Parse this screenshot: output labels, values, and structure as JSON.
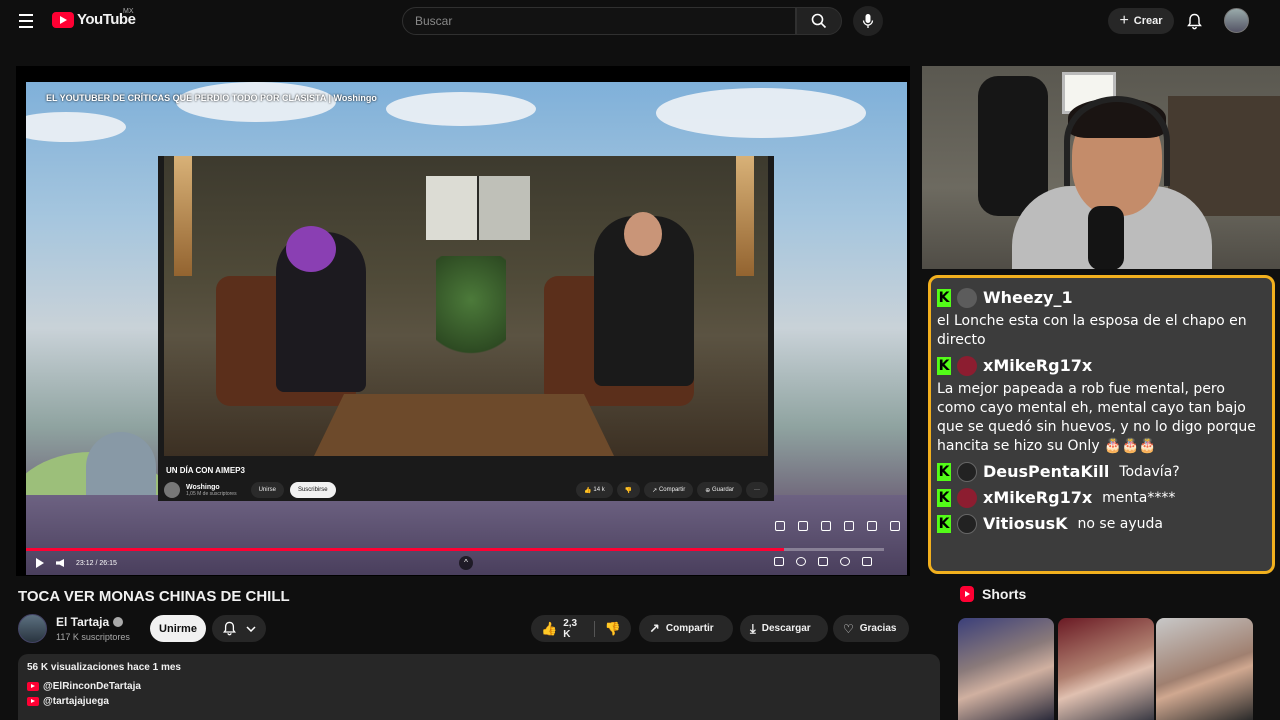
{
  "header": {
    "logo_text": "YouTube",
    "country_code": "MX",
    "search_placeholder": "Buscar",
    "create_label": "Crear"
  },
  "player": {
    "overlay_title": "EL YOUTUBER DE CRÍTICAS QUE PERDIO TODO POR CLASISTA | Woshingo",
    "inner": {
      "title": "UN DÍA CON AIMEP3",
      "channel": "Woshingo",
      "subs": "1,05 M de suscriptores",
      "join": "Unirse",
      "subscribe": "Suscribirse",
      "likes": "14 k",
      "share": "Compartir",
      "save": "Guardar"
    },
    "time_current": "23:12",
    "time_total": "26:15",
    "time_display": "23:12 / 26:15",
    "progress_fraction": 0.884
  },
  "stream": {
    "chat": [
      {
        "user": "Wheezy_1",
        "avatar": "gray",
        "text": "el Lonche esta con la esposa de el chapo en directo",
        "inline": false
      },
      {
        "user": "xMikeRg17x",
        "avatar": "red",
        "text": "La mejor papeada a rob fue mental, pero como cayo mental eh, mental cayo tan bajo que se quedó sin huevos, y no lo digo porque hancita se hizo su Only 🎂🎂🎂",
        "inline": false
      },
      {
        "user": "DeusPentaKill",
        "avatar": "dark",
        "text": "Todavía?",
        "inline": true
      },
      {
        "user": "xMikeRg17x",
        "avatar": "red",
        "text": "menta****",
        "inline": true
      },
      {
        "user": "VitiosusK",
        "avatar": "dark",
        "text": "no se ayuda",
        "inline": true
      }
    ]
  },
  "video": {
    "title": "TOCA VER MONAS CHINAS DE CHILL",
    "channel_name": "El Tartaja",
    "subscribers": "117 K suscriptores",
    "join_label": "Unirme",
    "likes": "2,3 K",
    "share_label": "Compartir",
    "download_label": "Descargar",
    "thanks_label": "Gracias",
    "views_meta": "56 K visualizaciones  hace 1 mes",
    "links": [
      "@ElRinconDeTartaja",
      "@tartajajuega"
    ]
  },
  "shorts": {
    "title": "Shorts"
  },
  "colors": {
    "accent": "#ff0033",
    "chat_border": "#f2b01e",
    "kick_green": "#53fc18"
  }
}
